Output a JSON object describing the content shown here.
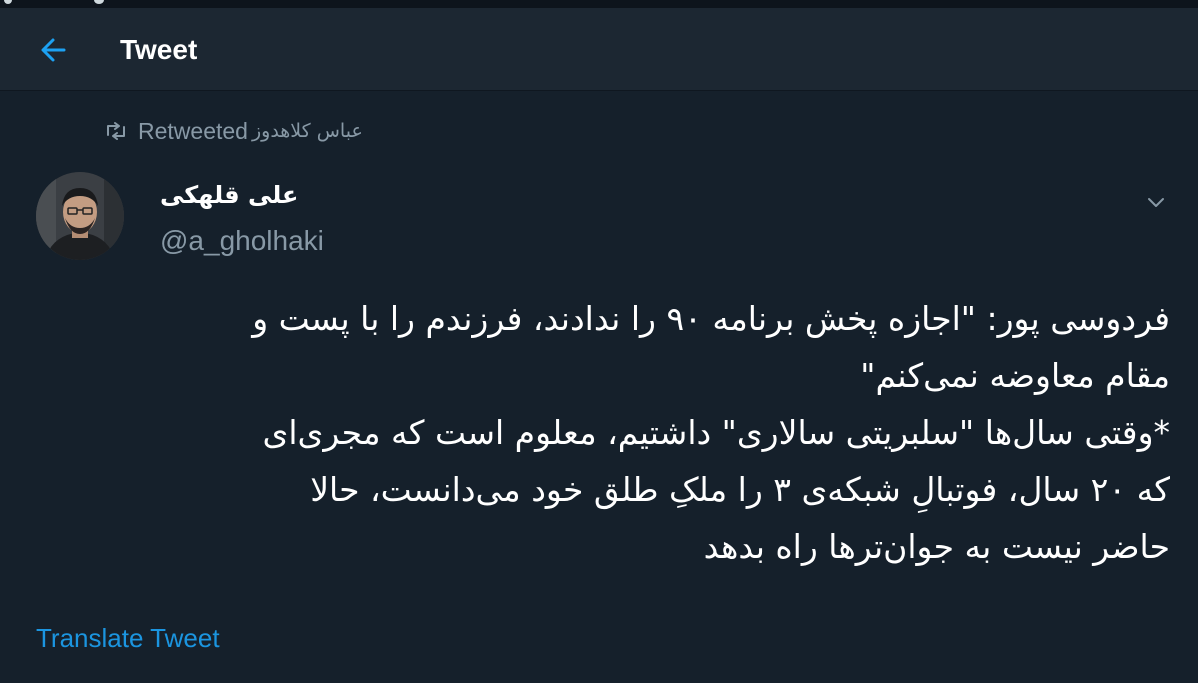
{
  "header": {
    "title": "Tweet",
    "back_icon": "arrow-left-icon",
    "accent": "#1da1f2"
  },
  "retweet": {
    "icon": "retweet-icon",
    "label": "Retweeted",
    "name": "عباس کلاهدوز"
  },
  "author": {
    "display_name": "علی قلهکی",
    "handle": "@a_gholhaki",
    "avatar": "avatar-photo"
  },
  "tweet": {
    "lines": [
      "فردوسی پور: \"اجازه پخش برنامه ۹۰ را ندادند، فرزندم را با پست و",
      "مقام معاوضه نمی‌کنم\"",
      "*وقتی سال‌ها \"سلبریتی سالاری\" داشتیم، معلوم است که مجری‌ای",
      "که ۲۰ سال، فوتبالِ شبکه‌ی ۳ را ملکِ طلق خود می‌دانست، حالا",
      "حاضر نیست به جوان‌ترها راه بدهد"
    ]
  },
  "translate_label": "Translate Tweet",
  "colors": {
    "background": "#15202b",
    "header": "#1c2732",
    "secondary_text": "#8899a6",
    "link": "#1b95e0"
  }
}
